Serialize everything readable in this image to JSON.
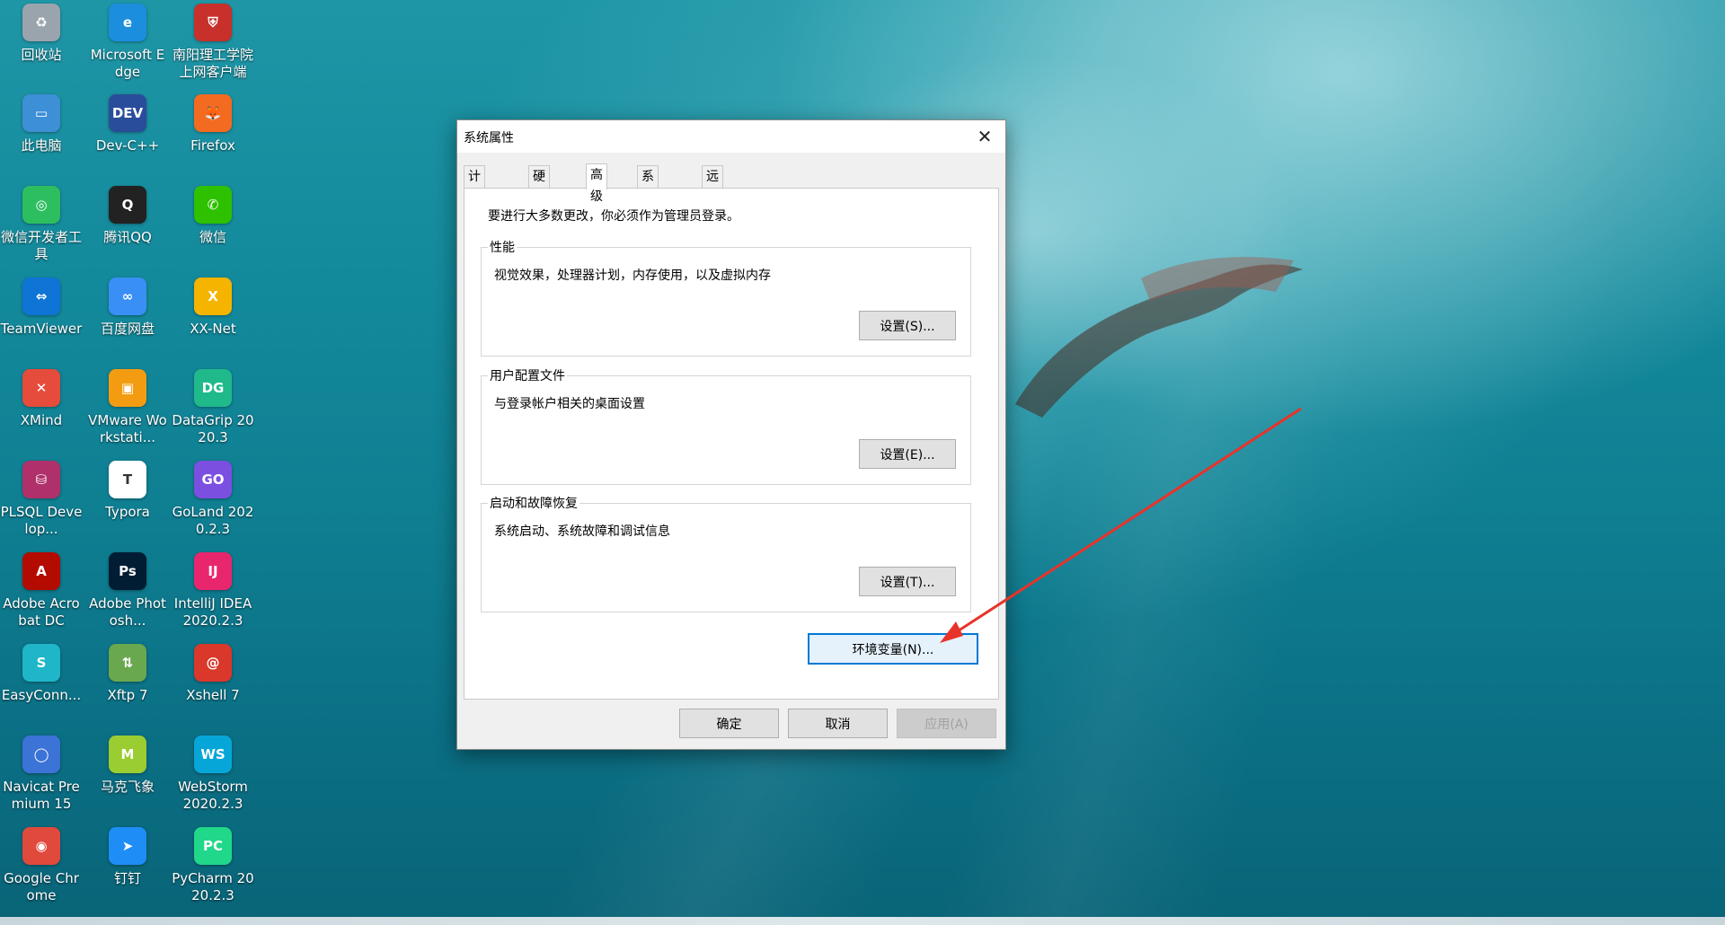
{
  "desktop": {
    "icons": [
      {
        "label": "回收站",
        "icon": "recycle-bin-icon",
        "color": "#9aa4ad",
        "glyph": "♻"
      },
      {
        "label": "Microsoft Edge",
        "icon": "edge-icon",
        "color": "#1c8ede",
        "glyph": "e"
      },
      {
        "label": "南阳理工学院上网客户端",
        "icon": "nyist-client-icon",
        "color": "#c8302c",
        "glyph": "⛨"
      },
      {
        "label": "此电脑",
        "icon": "this-pc-icon",
        "color": "#3d8fd6",
        "glyph": "▭"
      },
      {
        "label": "Dev-C++",
        "icon": "devcpp-icon",
        "color": "#2a4d9b",
        "glyph": "DEV"
      },
      {
        "label": "Firefox",
        "icon": "firefox-icon",
        "color": "#f26b21",
        "glyph": "🦊"
      },
      {
        "label": "微信开发者工具",
        "icon": "wechat-devtools-icon",
        "color": "#2dbe5f",
        "glyph": "◎"
      },
      {
        "label": "腾讯QQ",
        "icon": "qq-icon",
        "color": "#222222",
        "glyph": "Q"
      },
      {
        "label": "微信",
        "icon": "wechat-icon",
        "color": "#2dc100",
        "glyph": "✆"
      },
      {
        "label": "TeamViewer",
        "icon": "teamviewer-icon",
        "color": "#0e74d6",
        "glyph": "⇔"
      },
      {
        "label": "百度网盘",
        "icon": "baidu-netdisk-icon",
        "color": "#3a8ff6",
        "glyph": "∞"
      },
      {
        "label": "XX-Net",
        "icon": "xxnet-icon",
        "color": "#f4b400",
        "glyph": "X"
      },
      {
        "label": "XMind",
        "icon": "xmind-icon",
        "color": "#e54c3c",
        "glyph": "✕"
      },
      {
        "label": "VMware Workstati...",
        "icon": "vmware-icon",
        "color": "#f39c12",
        "glyph": "▣"
      },
      {
        "label": "DataGrip 2020.3",
        "icon": "datagrip-icon",
        "color": "#1fb98a",
        "glyph": "DG"
      },
      {
        "label": "PLSQL Develop...",
        "icon": "plsql-icon",
        "color": "#b0306b",
        "glyph": "⛁"
      },
      {
        "label": "Typora",
        "icon": "typora-icon",
        "color": "#ffffff",
        "glyph": "T"
      },
      {
        "label": "GoLand 2020.2.3",
        "icon": "goland-icon",
        "color": "#7b4fe0",
        "glyph": "GO"
      },
      {
        "label": "Adobe Acrobat DC",
        "icon": "acrobat-icon",
        "color": "#b30b00",
        "glyph": "A"
      },
      {
        "label": "Adobe Photosh...",
        "icon": "photoshop-icon",
        "color": "#001d34",
        "glyph": "Ps"
      },
      {
        "label": "IntelliJ IDEA 2020.2.3",
        "icon": "intellij-icon",
        "color": "#e8266e",
        "glyph": "IJ"
      },
      {
        "label": "EasyConn...",
        "icon": "easyconnect-icon",
        "color": "#1fb6c9",
        "glyph": "S"
      },
      {
        "label": "Xftp 7",
        "icon": "xftp-icon",
        "color": "#6aa84f",
        "glyph": "⇅"
      },
      {
        "label": "Xshell 7",
        "icon": "xshell-icon",
        "color": "#d9382b",
        "glyph": "@"
      },
      {
        "label": "Navicat Premium 15",
        "icon": "navicat-icon",
        "color": "#3b73d6",
        "glyph": "◯"
      },
      {
        "label": "马克飞象",
        "icon": "maxiang-icon",
        "color": "#9acd32",
        "glyph": "M"
      },
      {
        "label": "WebStorm 2020.2.3",
        "icon": "webstorm-icon",
        "color": "#07a6d8",
        "glyph": "WS"
      },
      {
        "label": "Google Chrome",
        "icon": "chrome-icon",
        "color": "#e04a3c",
        "glyph": "◉"
      },
      {
        "label": "钉钉",
        "icon": "dingtalk-icon",
        "color": "#1e8df5",
        "glyph": "➤"
      },
      {
        "label": "PyCharm 2020.2.3",
        "icon": "pycharm-icon",
        "color": "#21d789",
        "glyph": "PC"
      }
    ]
  },
  "dialog": {
    "title": "系统属性",
    "close_icon": "close-icon",
    "tabs": [
      {
        "label": "计算机名",
        "active": false
      },
      {
        "label": "硬件",
        "active": false
      },
      {
        "label": "高级",
        "active": true
      },
      {
        "label": "系统保护",
        "active": false
      },
      {
        "label": "远程",
        "active": false
      }
    ],
    "notice": "要进行大多数更改，你必须作为管理员登录。",
    "groups": {
      "performance": {
        "label": "性能",
        "desc": "视觉效果，处理器计划，内存使用，以及虚拟内存",
        "button": "设置(S)..."
      },
      "profiles": {
        "label": "用户配置文件",
        "desc": "与登录帐户相关的桌面设置",
        "button": "设置(E)..."
      },
      "startup": {
        "label": "启动和故障恢复",
        "desc": "系统启动、系统故障和调试信息",
        "button": "设置(T)..."
      }
    },
    "env_button": "环境变量(N)...",
    "ok_button": "确定",
    "cancel_button": "取消",
    "apply_button": "应用(A)",
    "apply_enabled": false
  },
  "annotation": {
    "arrow_color": "#e8332a"
  }
}
